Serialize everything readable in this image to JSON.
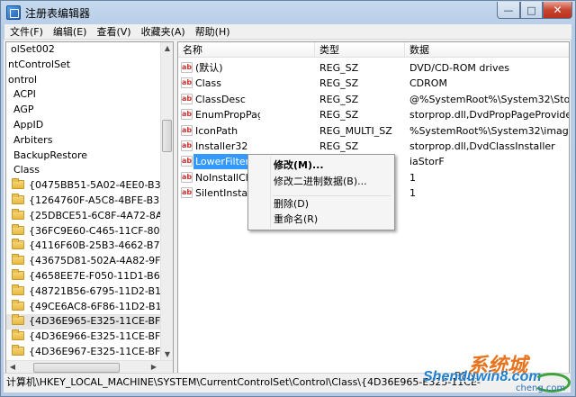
{
  "window": {
    "title": "注册表编辑器",
    "controls": {
      "minimize": "—",
      "maximize": "□",
      "close": "✕"
    }
  },
  "menu": [
    "文件(F)",
    "编辑(E)",
    "查看(V)",
    "收藏夹(A)",
    "帮助(H)"
  ],
  "tree": {
    "items": [
      {
        "label": "olSet002",
        "folder": false
      },
      {
        "label": "ntControlSet",
        "folder": false
      },
      {
        "label": "ontrol",
        "folder": false
      },
      {
        "label": "ACPI",
        "folder": false
      },
      {
        "label": "AGP",
        "folder": false
      },
      {
        "label": "AppID",
        "folder": false
      },
      {
        "label": "Arbiters",
        "folder": false
      },
      {
        "label": "BackupRestore",
        "folder": false
      },
      {
        "label": "Class",
        "folder": false
      },
      {
        "label": "{0475BB51-5A02-4EE0-B36C-2",
        "folder": true
      },
      {
        "label": "{1264760F-A5C8-4BFE-B314-D",
        "folder": true
      },
      {
        "label": "{25DBCE51-6C8F-4A72-8A6D-",
        "folder": true
      },
      {
        "label": "{36FC9E60-C465-11CF-8056-4",
        "folder": true
      },
      {
        "label": "{4116F60B-25B3-4662-B732-9",
        "folder": true
      },
      {
        "label": "{43675D81-502A-4A82-9F84-B",
        "folder": true
      },
      {
        "label": "{4658EE7E-F050-11D1-B6BD-C",
        "folder": true
      },
      {
        "label": "{48721B56-6795-11D2-B1A8-C",
        "folder": true
      },
      {
        "label": "{49CE6AC8-6F86-11D2-B1E5-C",
        "folder": true
      },
      {
        "label": "{4D36E965-E325-11CE-BFC1-C",
        "folder": true
      },
      {
        "label": "{4D36E966-E325-11CE-BFC1-C",
        "folder": true
      },
      {
        "label": "{4D36E967-E325-11CE-BFC1-C",
        "folder": true
      },
      {
        "label": "{4D36E968-E325-11CE-BFC1-C",
        "folder": true
      }
    ],
    "selected_index": 18
  },
  "list": {
    "columns": [
      "名称",
      "类型",
      "数据"
    ],
    "rows": [
      {
        "name": "(默认)",
        "type": "REG_SZ",
        "data": "DVD/CD-ROM drives"
      },
      {
        "name": "Class",
        "type": "REG_SZ",
        "data": "CDROM"
      },
      {
        "name": "ClassDesc",
        "type": "REG_SZ",
        "data": "@%SystemRoot%\\System32\\StorPro"
      },
      {
        "name": "EnumPropPages32",
        "type": "REG_SZ",
        "data": "storprop.dll,DvdPropPageProvider"
      },
      {
        "name": "IconPath",
        "type": "REG_MULTI_SZ",
        "data": "%SystemRoot%\\System32\\imageres."
      },
      {
        "name": "Installer32",
        "type": "REG_SZ",
        "data": "storprop.dll,DvdClassInstaller"
      },
      {
        "name": "LowerFilters",
        "type": "",
        "data": "iaStorF"
      },
      {
        "name": "NoInstallClas",
        "type": "",
        "data": "1"
      },
      {
        "name": "SilentInstall",
        "type": "",
        "data": "1"
      }
    ],
    "selected_index": 6
  },
  "context_menu": {
    "items": [
      "修改(M)...",
      "修改二进制数据(B)...",
      "删除(D)",
      "重命名(R)"
    ]
  },
  "status": {
    "path": "计算机\\HKEY_LOCAL_MACHINE\\SYSTEM\\CurrentControlSet\\Control\\Class\\{4D36E965-E325-11CE-"
  },
  "watermark": {
    "brand": "系统城",
    "domain": "Shenduwin8.com",
    "small": "BRN",
    "tail": "cheng.com"
  },
  "colors": {
    "selection": "#3399ff",
    "title_bar": "#b9cfe6",
    "close_button": "#c8452f"
  }
}
